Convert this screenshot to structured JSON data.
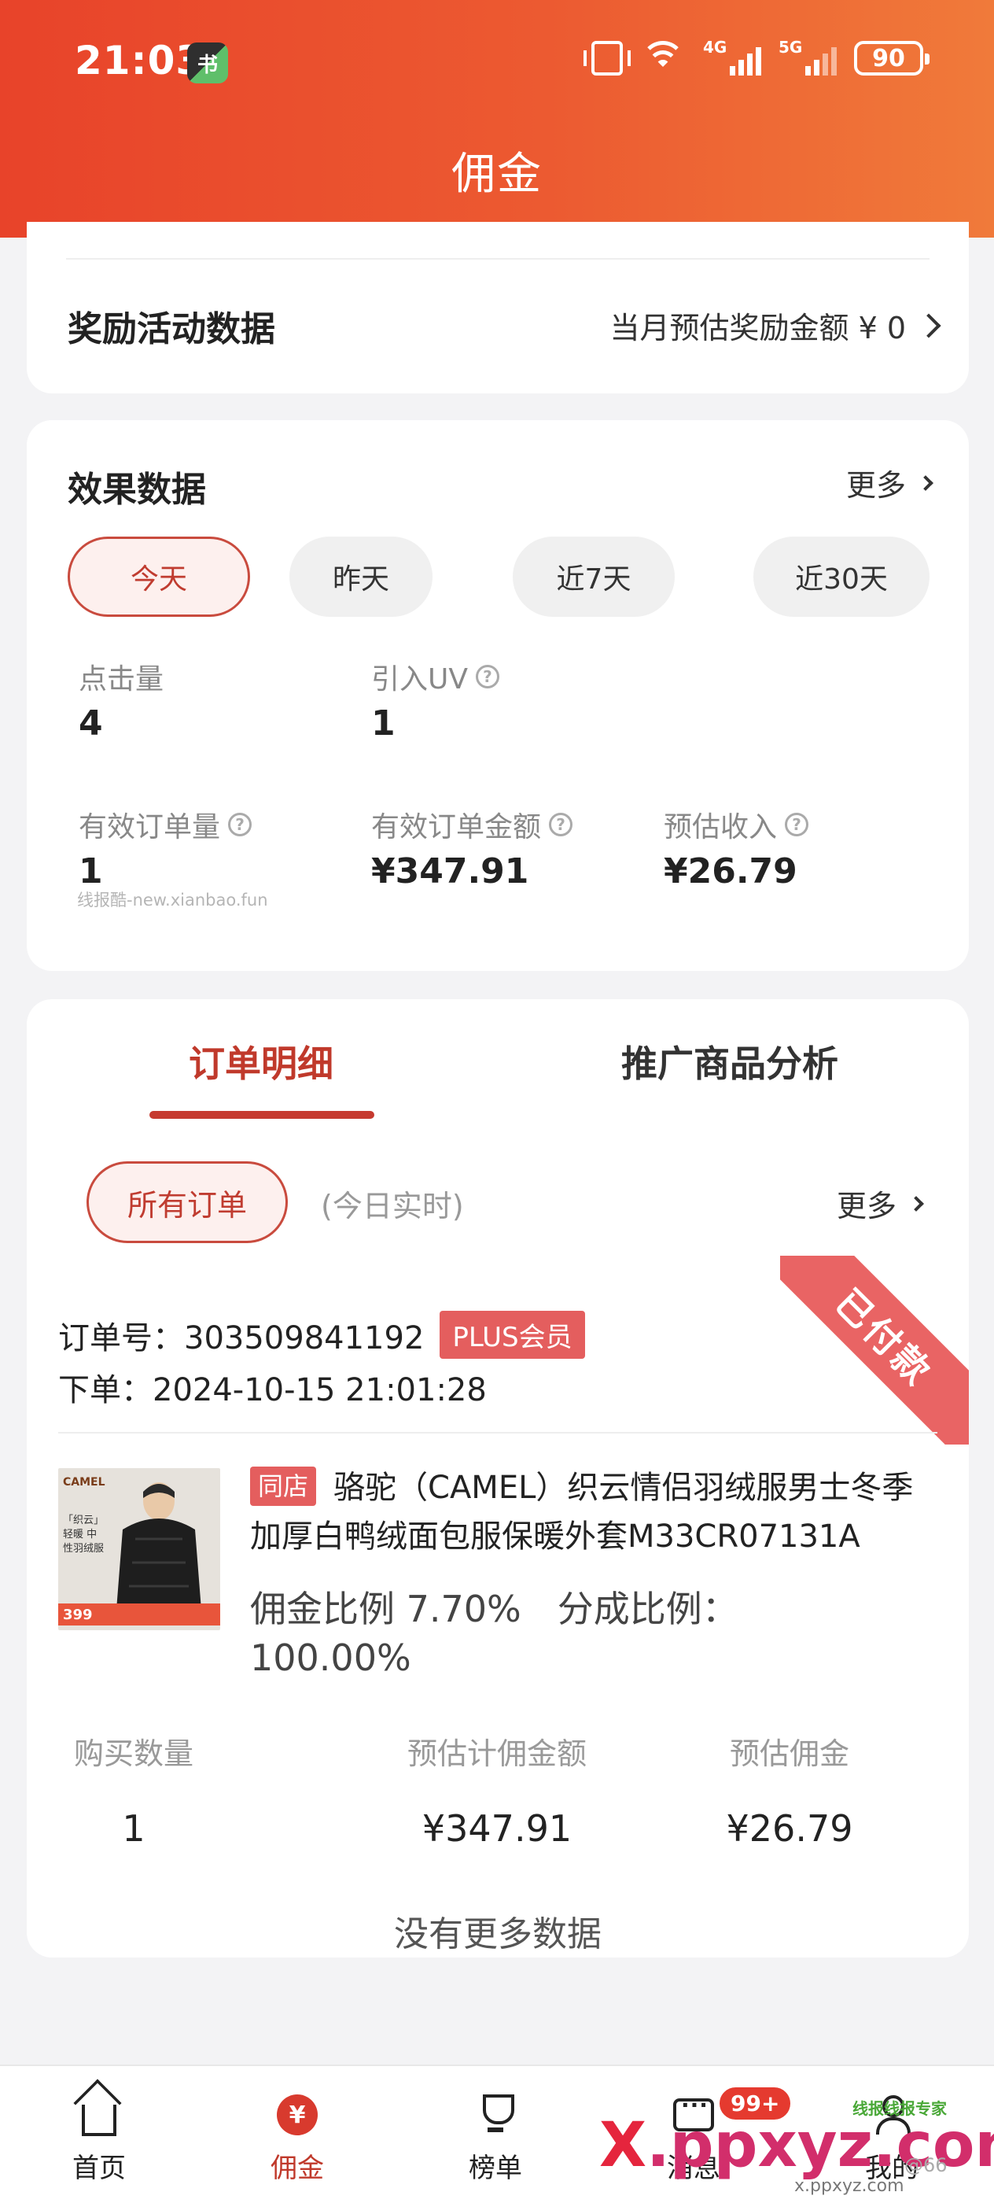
{
  "status_bar": {
    "time": "21:03",
    "app_badge": "书",
    "signal_4g": "4G",
    "signal_5g": "5G",
    "battery": "90"
  },
  "header": {
    "title": "佣金"
  },
  "reward": {
    "title": "奖励活动数据",
    "summary": "当月预估奖励金额 ¥ 0"
  },
  "effect": {
    "title": "效果数据",
    "more": "更多",
    "ranges": [
      "今天",
      "昨天",
      "近7天",
      "近30天"
    ],
    "active_range": "今天",
    "stats": {
      "clicks": {
        "label": "点击量",
        "value": "4"
      },
      "uv": {
        "label": "引入UV",
        "value": "1"
      },
      "orders": {
        "label": "有效订单量",
        "value": "1"
      },
      "amount": {
        "label": "有效订单金额",
        "value": "¥347.91"
      },
      "income": {
        "label": "预估收入",
        "value": "¥26.79"
      }
    },
    "watermark": "线报酷-new.xianbao.fun"
  },
  "orders": {
    "tabs": [
      "订单明细",
      "推广商品分析"
    ],
    "filter": "所有订单",
    "realtime": "(今日实时)",
    "more": "更多",
    "status": "已付款",
    "order_no": "订单号：303509841192",
    "member_badge": "PLUS会员",
    "order_time": "下单：2024-10-15 21:01:28",
    "product": {
      "shop_badge": "同店",
      "title": "骆驼（CAMEL）织云情侣羽绒服男士冬季加厚白鸭绒面包服保暖外套M33CR07131A",
      "commission_rate": "佣金比例 7.70%",
      "share_rate": "分成比例：100.00%",
      "thumb_brand": "CAMEL",
      "thumb_text": "「织云」轻暖 中性羽绒服",
      "thumb_price": "399"
    },
    "columns": [
      {
        "label": "购买数量",
        "value": "1"
      },
      {
        "label": "预估计佣金额",
        "value": "¥347.91"
      },
      {
        "label": "预估佣金",
        "value": "¥26.79"
      }
    ],
    "no_more": "没有更多数据"
  },
  "nav": {
    "items": [
      "首页",
      "佣金",
      "榜单",
      "消息",
      "我的"
    ],
    "active": "佣金",
    "message_badge": "99+"
  },
  "watermarks": {
    "brand_x": "X",
    "brand_rest": ".ppxyz.com",
    "url": "x.ppxyz.com",
    "top": "线报线报专家",
    "user": "@66"
  }
}
